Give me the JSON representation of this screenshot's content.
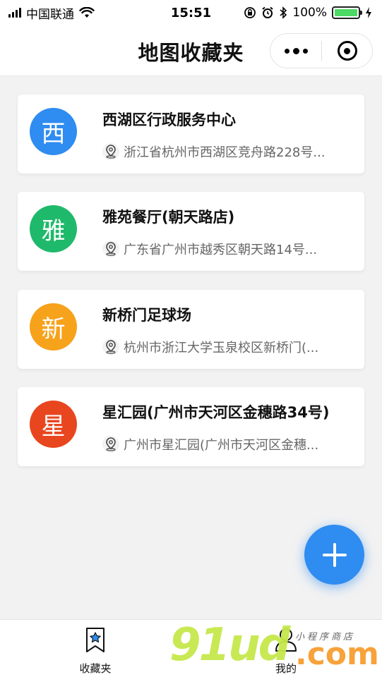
{
  "status_bar": {
    "carrier": "中国联通",
    "time": "15:51",
    "battery": "100%",
    "battery_level": 1.0
  },
  "nav": {
    "title": "地图收藏夹"
  },
  "favorites": [
    {
      "initial": "西",
      "color": "#2f8cf0",
      "name": "西湖区行政服务中心",
      "address": "浙江省杭州市西湖区竞舟路228号..."
    },
    {
      "initial": "雅",
      "color": "#1fb96b",
      "name": "雅苑餐厅(朝天路店)",
      "address": "广东省广州市越秀区朝天路14号..."
    },
    {
      "initial": "新",
      "color": "#f7a21b",
      "name": "新桥门足球场",
      "address": "杭州市浙江大学玉泉校区新桥门(..."
    },
    {
      "initial": "星",
      "color": "#e8461f",
      "name": "星汇园(广州市天河区金穗路34号)",
      "address": "广州市星汇园(广州市天河区金穗..."
    }
  ],
  "fab": {
    "icon": "plus-icon"
  },
  "tabs": [
    {
      "label": "收藏夹",
      "icon": "bookmark-star-icon",
      "active": true
    },
    {
      "label": "我的",
      "icon": "user-icon",
      "active": false
    }
  ],
  "watermark": {
    "main": "91ud",
    "suffix": ".com",
    "tagline": "小程序商店"
  }
}
